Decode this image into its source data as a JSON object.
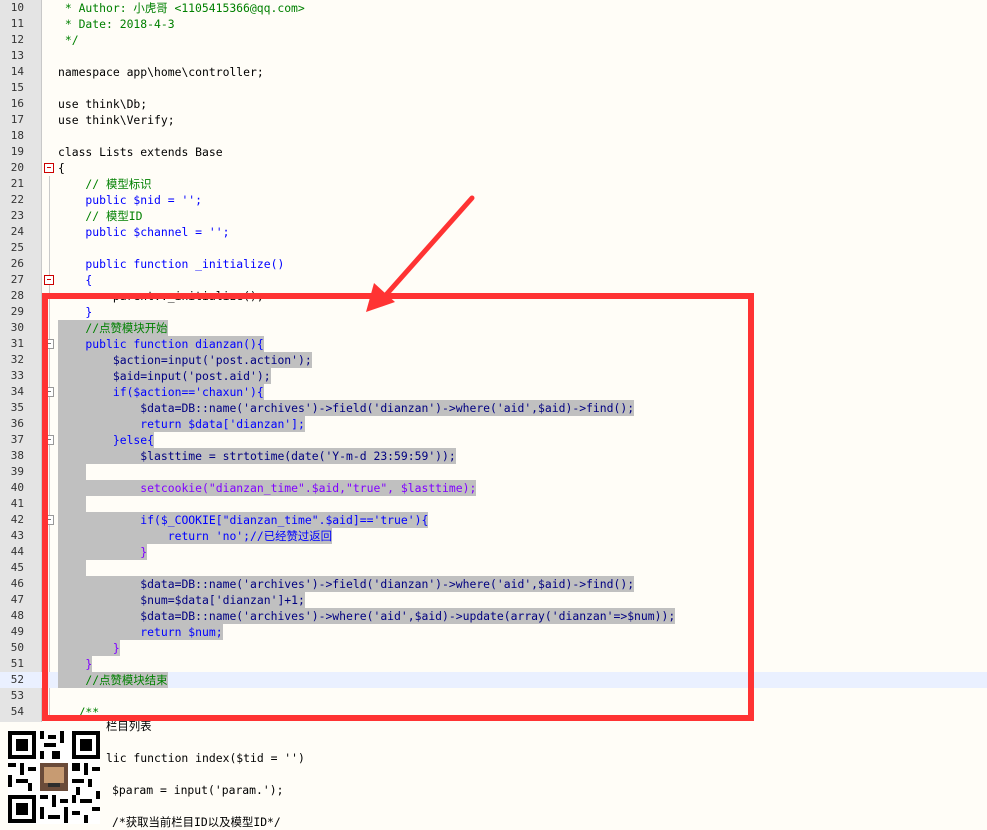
{
  "editor": {
    "lines": [
      {
        "n": "10",
        "t": " * Author: 小虎哥 <1105415366@qq.com>"
      },
      {
        "n": "11",
        "t": " * Date: 2018-4-3"
      },
      {
        "n": "12",
        "t": " */"
      },
      {
        "n": "13",
        "t": ""
      },
      {
        "n": "14",
        "t": "namespace app\\home\\controller;"
      },
      {
        "n": "15",
        "t": ""
      },
      {
        "n": "16",
        "t": "use think\\Db;"
      },
      {
        "n": "17",
        "t": "use think\\Verify;"
      },
      {
        "n": "18",
        "t": ""
      },
      {
        "n": "19",
        "t": "class Lists extends Base"
      },
      {
        "n": "20",
        "t": "{"
      },
      {
        "n": "21",
        "t": "    // 模型标识"
      },
      {
        "n": "22",
        "t": "    public $nid = '';"
      },
      {
        "n": "23",
        "t": "    // 模型ID"
      },
      {
        "n": "24",
        "t": "    public $channel = '';"
      },
      {
        "n": "25",
        "t": ""
      },
      {
        "n": "26",
        "t": "    public function _initialize()"
      },
      {
        "n": "27",
        "t": "    {"
      },
      {
        "n": "28",
        "t": "        parent::_initialize();"
      },
      {
        "n": "29",
        "t": "    }"
      },
      {
        "n": "30",
        "t": "    //点赞模块开始"
      },
      {
        "n": "31",
        "t": "    public function dianzan(){"
      },
      {
        "n": "32",
        "t": "        $action=input('post.action');"
      },
      {
        "n": "33",
        "t": "        $aid=input('post.aid');"
      },
      {
        "n": "34",
        "t": "        if($action=='chaxun'){"
      },
      {
        "n": "35",
        "t": "            $data=DB::name('archives')->field('dianzan')->where('aid',$aid)->find();"
      },
      {
        "n": "36",
        "t": "            return $data['dianzan'];"
      },
      {
        "n": "37",
        "t": "        }else{"
      },
      {
        "n": "38",
        "t": "            $lasttime = strtotime(date('Y-m-d 23:59:59'));"
      },
      {
        "n": "39",
        "t": ""
      },
      {
        "n": "40",
        "t": "            setcookie(\"dianzan_time\".$aid,\"true\", $lasttime);"
      },
      {
        "n": "41",
        "t": ""
      },
      {
        "n": "42",
        "t": "            if($_COOKIE[\"dianzan_time\".$aid]=='true'){"
      },
      {
        "n": "43",
        "t": "                return 'no';//已经赞过返回"
      },
      {
        "n": "44",
        "t": "            }"
      },
      {
        "n": "45",
        "t": ""
      },
      {
        "n": "46",
        "t": "            $data=DB::name('archives')->field('dianzan')->where('aid',$aid)->find();"
      },
      {
        "n": "47",
        "t": "            $num=$data['dianzan']+1;"
      },
      {
        "n": "48",
        "t": "            $data=DB::name('archives')->where('aid',$aid)->update(array('dianzan'=>$num));"
      },
      {
        "n": "49",
        "t": "            return $num;"
      },
      {
        "n": "50",
        "t": "        }"
      },
      {
        "n": "51",
        "t": "    }"
      },
      {
        "n": "52",
        "t": "    //点赞模块结束"
      },
      {
        "n": "53",
        "t": ""
      },
      {
        "n": "54",
        "t": "   /**"
      }
    ],
    "below": [
      "栏目列表",
      "lic function index($tid = '')",
      "",
      "$param = input('param.');",
      "",
      "/*获取当前栏目ID以及模型ID*/"
    ]
  },
  "colors": {
    "selection": "#c0c0c0",
    "annotation": "#ff3333",
    "comment": "#008000",
    "keyword": "#0000ff"
  },
  "icons": [
    "fold-collapse-icon",
    "arrow-annotation-icon",
    "qr-code-image"
  ]
}
